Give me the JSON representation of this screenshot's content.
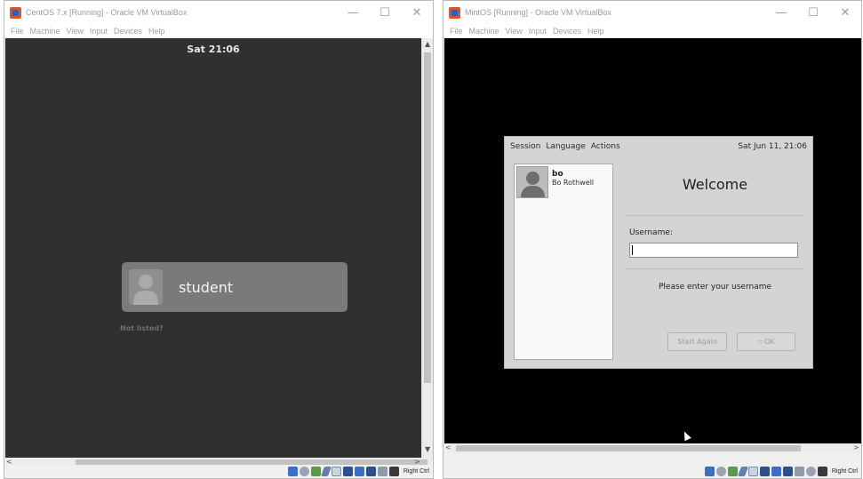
{
  "left_window": {
    "title": "CentOS 7.x [Running] - Oracle VM VirtualBox",
    "controls": {
      "minimize": "—",
      "maximize": "☐",
      "close": "✕"
    },
    "menu": [
      "File",
      "Machine",
      "View",
      "Input",
      "Devices",
      "Help"
    ],
    "guest": {
      "clock": "Sat 21:06",
      "user_name": "student",
      "not_listed": "Not listed?"
    },
    "status": {
      "host_key": "Right Ctrl"
    },
    "scroll_arrows": {
      "up": "▲",
      "down": "▼",
      "left": "<",
      "right": ">"
    }
  },
  "right_window": {
    "title": "MintOS [Running] - Oracle VM VirtualBox",
    "controls": {
      "minimize": "—",
      "maximize": "☐",
      "close": "✕"
    },
    "menu": [
      "File",
      "Machine",
      "View",
      "Input",
      "Devices",
      "Help"
    ],
    "guest": {
      "menus": [
        "Session",
        "Language",
        "Actions"
      ],
      "date": "Sat Jun 11, 21:06",
      "user_login": "bo",
      "user_full_name": "Bo Rothwell",
      "welcome": "Welcome",
      "username_label": "Username:",
      "username_value": "",
      "prompt": "Please enter your username",
      "start_again": "Start Again",
      "ok": "OK"
    },
    "status": {
      "host_key": "Right Ctrl"
    },
    "scroll_arrows": {
      "left": "<",
      "right": ">"
    }
  }
}
